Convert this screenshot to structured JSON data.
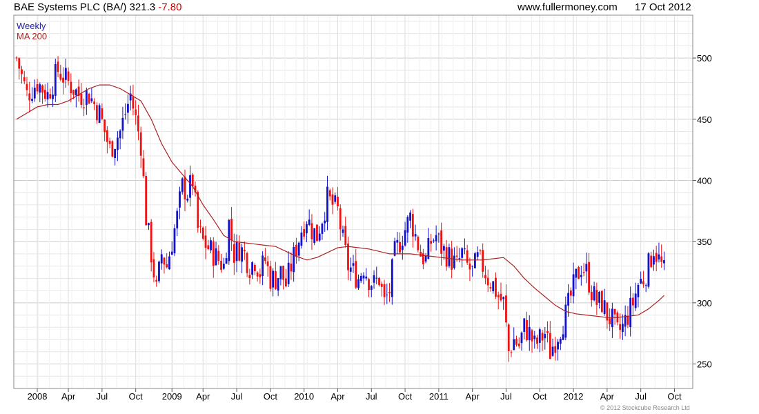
{
  "header": {
    "symbol": "BAE Systems PLC (BA/)",
    "price": "321.3",
    "change": "-7.80",
    "website": "www.fullermoney.com",
    "date": "17 Oct 2012"
  },
  "legend": {
    "weekly": "Weekly",
    "ma": "MA 200"
  },
  "copyright": "© 2012 Stockcube Research Ltd",
  "colors": {
    "up": "#1111cc",
    "down": "#ee1111",
    "ma": "#aa2222",
    "grid": "#dddddd"
  },
  "chart_data": {
    "type": "candlestick",
    "ylim": [
      230,
      535
    ],
    "yticks": [
      250,
      300,
      350,
      400,
      450,
      500
    ],
    "xlim": [
      0,
      250
    ],
    "xticks": [
      {
        "x": 8,
        "label": "2008"
      },
      {
        "x": 20,
        "label": "Apr"
      },
      {
        "x": 33,
        "label": "Jul"
      },
      {
        "x": 46,
        "label": "Oct"
      },
      {
        "x": 60,
        "label": "2009"
      },
      {
        "x": 72,
        "label": "Apr"
      },
      {
        "x": 85,
        "label": "Jul"
      },
      {
        "x": 98,
        "label": "Oct"
      },
      {
        "x": 111,
        "label": "2010"
      },
      {
        "x": 124,
        "label": "Apr"
      },
      {
        "x": 137,
        "label": "Jul"
      },
      {
        "x": 150,
        "label": "Oct"
      },
      {
        "x": 163,
        "label": "2011"
      },
      {
        "x": 176,
        "label": "Apr"
      },
      {
        "x": 189,
        "label": "Jul"
      },
      {
        "x": 202,
        "label": "Oct"
      },
      {
        "x": 215,
        "label": "2012"
      },
      {
        "x": 228,
        "label": "Apr"
      },
      {
        "x": 241,
        "label": "Jul"
      },
      {
        "x": 254,
        "label": "Oct"
      }
    ],
    "close_path": [
      [
        0,
        500
      ],
      [
        4,
        470
      ],
      [
        8,
        480
      ],
      [
        12,
        470
      ],
      [
        16,
        490
      ],
      [
        20,
        480
      ],
      [
        24,
        470
      ],
      [
        28,
        470
      ],
      [
        32,
        455
      ],
      [
        36,
        425
      ],
      [
        40,
        440
      ],
      [
        44,
        470
      ],
      [
        48,
        430
      ],
      [
        50,
        370
      ],
      [
        52,
        340
      ],
      [
        54,
        310
      ],
      [
        56,
        340
      ],
      [
        58,
        330
      ],
      [
        60,
        350
      ],
      [
        62,
        370
      ],
      [
        64,
        395
      ],
      [
        66,
        390
      ],
      [
        68,
        400
      ],
      [
        70,
        360
      ],
      [
        72,
        350
      ],
      [
        74,
        345
      ],
      [
        76,
        340
      ],
      [
        78,
        335
      ],
      [
        80,
        330
      ],
      [
        82,
        365
      ],
      [
        84,
        340
      ],
      [
        86,
        345
      ],
      [
        88,
        340
      ],
      [
        90,
        330
      ],
      [
        92,
        335
      ],
      [
        94,
        325
      ],
      [
        96,
        335
      ],
      [
        98,
        320
      ],
      [
        100,
        320
      ],
      [
        102,
        325
      ],
      [
        104,
        315
      ],
      [
        106,
        330
      ],
      [
        108,
        345
      ],
      [
        110,
        360
      ],
      [
        112,
        370
      ],
      [
        114,
        360
      ],
      [
        116,
        355
      ],
      [
        118,
        370
      ],
      [
        120,
        385
      ],
      [
        122,
        380
      ],
      [
        124,
        375
      ],
      [
        126,
        350
      ],
      [
        128,
        330
      ],
      [
        130,
        325
      ],
      [
        132,
        320
      ],
      [
        134,
        330
      ],
      [
        136,
        320
      ],
      [
        138,
        315
      ],
      [
        140,
        320
      ],
      [
        142,
        300
      ],
      [
        144,
        310
      ],
      [
        146,
        340
      ],
      [
        148,
        350
      ],
      [
        150,
        360
      ],
      [
        152,
        370
      ],
      [
        154,
        355
      ],
      [
        156,
        340
      ],
      [
        158,
        335
      ],
      [
        160,
        350
      ],
      [
        162,
        355
      ],
      [
        164,
        345
      ],
      [
        166,
        340
      ],
      [
        168,
        335
      ],
      [
        170,
        330
      ],
      [
        172,
        340
      ],
      [
        174,
        330
      ],
      [
        176,
        325
      ],
      [
        178,
        335
      ],
      [
        180,
        330
      ],
      [
        182,
        320
      ],
      [
        184,
        315
      ],
      [
        186,
        305
      ],
      [
        188,
        300
      ],
      [
        190,
        260
      ],
      [
        192,
        270
      ],
      [
        194,
        265
      ],
      [
        196,
        280
      ],
      [
        198,
        275
      ],
      [
        200,
        265
      ],
      [
        202,
        270
      ],
      [
        204,
        275
      ],
      [
        206,
        260
      ],
      [
        208,
        270
      ],
      [
        210,
        280
      ],
      [
        212,
        290
      ],
      [
        214,
        305
      ],
      [
        216,
        320
      ],
      [
        218,
        330
      ],
      [
        220,
        325
      ],
      [
        222,
        310
      ],
      [
        224,
        300
      ],
      [
        226,
        300
      ],
      [
        228,
        290
      ],
      [
        230,
        285
      ],
      [
        232,
        275
      ],
      [
        234,
        280
      ],
      [
        236,
        290
      ],
      [
        238,
        300
      ],
      [
        240,
        315
      ],
      [
        242,
        320
      ],
      [
        244,
        330
      ],
      [
        246,
        345
      ],
      [
        248,
        335
      ],
      [
        250,
        325
      ]
    ],
    "ma_path": [
      [
        0,
        450
      ],
      [
        4,
        455
      ],
      [
        8,
        460
      ],
      [
        12,
        462
      ],
      [
        16,
        462
      ],
      [
        20,
        465
      ],
      [
        24,
        470
      ],
      [
        28,
        475
      ],
      [
        32,
        478
      ],
      [
        36,
        478
      ],
      [
        40,
        475
      ],
      [
        44,
        470
      ],
      [
        48,
        465
      ],
      [
        52,
        450
      ],
      [
        56,
        430
      ],
      [
        60,
        415
      ],
      [
        64,
        405
      ],
      [
        68,
        395
      ],
      [
        72,
        380
      ],
      [
        76,
        368
      ],
      [
        80,
        355
      ],
      [
        84,
        350
      ],
      [
        88,
        349
      ],
      [
        92,
        348
      ],
      [
        96,
        347
      ],
      [
        100,
        346
      ],
      [
        104,
        342
      ],
      [
        108,
        338
      ],
      [
        112,
        335
      ],
      [
        116,
        337
      ],
      [
        120,
        341
      ],
      [
        124,
        345
      ],
      [
        128,
        346
      ],
      [
        132,
        345
      ],
      [
        136,
        344
      ],
      [
        140,
        342
      ],
      [
        144,
        340
      ],
      [
        148,
        340
      ],
      [
        152,
        340
      ],
      [
        156,
        339
      ],
      [
        160,
        338
      ],
      [
        164,
        337
      ],
      [
        168,
        336
      ],
      [
        172,
        335
      ],
      [
        176,
        335
      ],
      [
        180,
        335
      ],
      [
        184,
        336
      ],
      [
        188,
        337
      ],
      [
        192,
        330
      ],
      [
        196,
        320
      ],
      [
        200,
        312
      ],
      [
        204,
        305
      ],
      [
        208,
        298
      ],
      [
        212,
        293
      ],
      [
        216,
        291
      ],
      [
        220,
        290
      ],
      [
        224,
        289
      ],
      [
        228,
        288
      ],
      [
        232,
        288
      ],
      [
        236,
        289
      ],
      [
        240,
        290
      ],
      [
        244,
        295
      ],
      [
        248,
        302
      ],
      [
        250,
        306
      ]
    ]
  }
}
